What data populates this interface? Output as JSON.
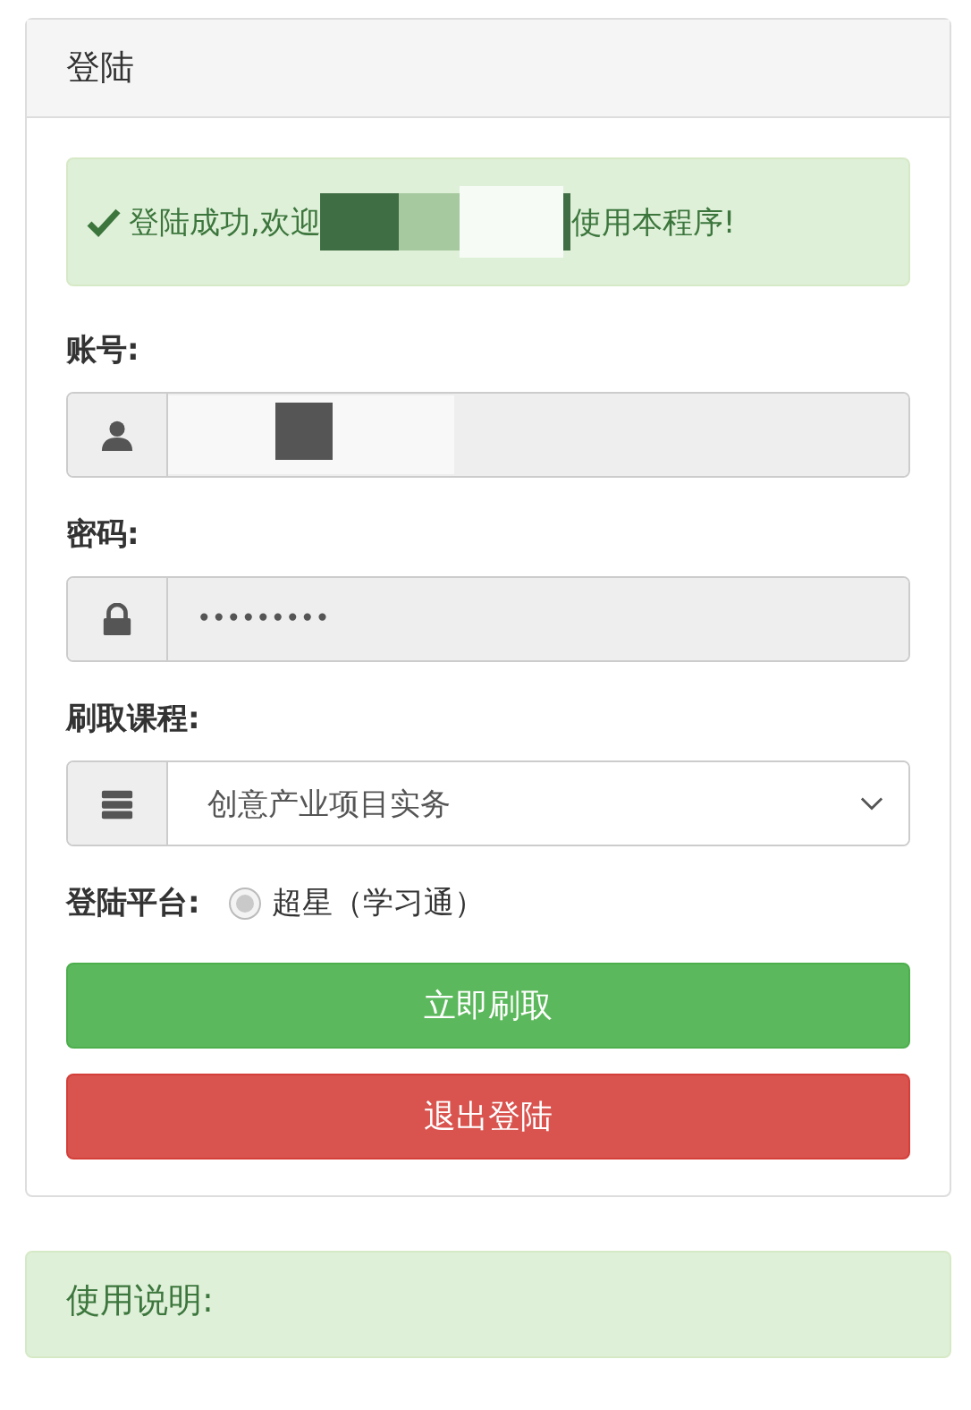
{
  "panel": {
    "title": "登陆"
  },
  "alert": {
    "text_before": "登陆成功,欢迎",
    "text_after": "使用本程序!"
  },
  "account": {
    "label": "账号:"
  },
  "password": {
    "label": "密码:",
    "value": "•••••••••"
  },
  "course": {
    "label": "刷取课程:",
    "value": "创意产业项目实务"
  },
  "platform": {
    "label": "登陆平台:",
    "options": [
      {
        "label": "超星（学习通）",
        "selected": true
      }
    ]
  },
  "buttons": [
    {
      "label": "立即刷取",
      "kind": "primary"
    },
    {
      "label": "退出登陆",
      "kind": "danger"
    }
  ],
  "help_panel": {
    "title": "使用说明:"
  }
}
